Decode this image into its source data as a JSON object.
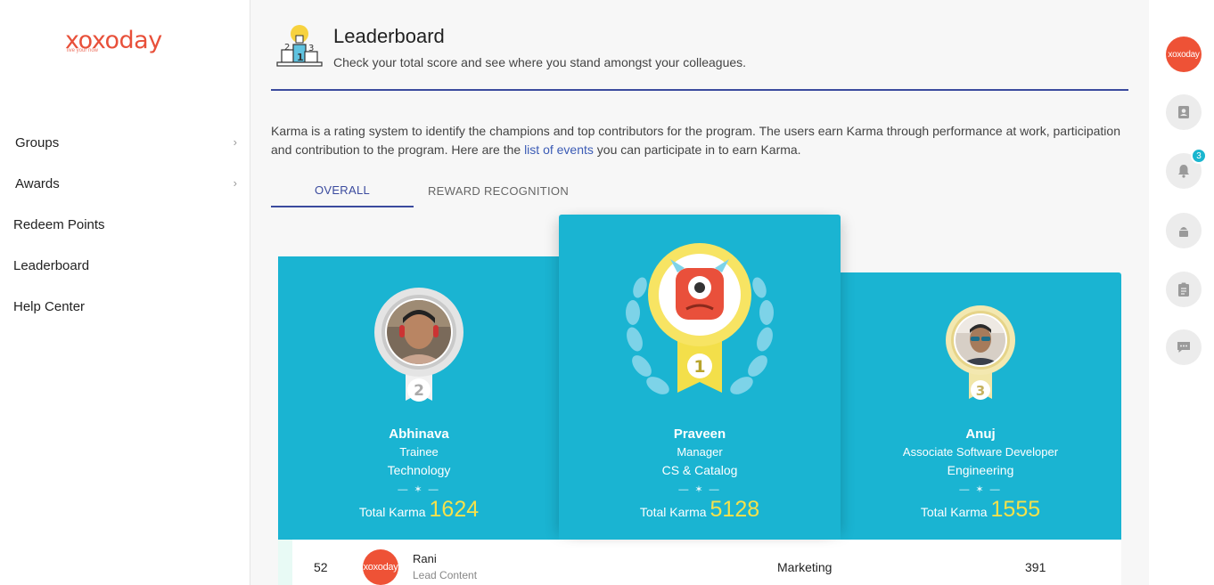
{
  "brand": {
    "logo_text": "xoxoday",
    "logo_tagline": "live your now"
  },
  "sidebar": {
    "items": [
      {
        "label": "Groups",
        "has_submenu": true
      },
      {
        "label": "Awards",
        "has_submenu": true
      },
      {
        "label": "Redeem Points",
        "has_submenu": false
      },
      {
        "label": "Leaderboard",
        "has_submenu": false
      },
      {
        "label": "Help Center",
        "has_submenu": false
      }
    ],
    "chevron": "›"
  },
  "header": {
    "title": "Leaderboard",
    "subtitle": "Check your total score and see where you stand amongst your colleagues.",
    "icon": "podium-icon",
    "icon_numbers": [
      "2",
      "1",
      "3"
    ]
  },
  "intro": {
    "text_before": "Karma is a rating system to identify the champions and top contributors for the program. The users earn Karma through performance at work, participation and contribution to the program. Here are the ",
    "link_text": "list of events",
    "text_after": " you can participate in to earn Karma."
  },
  "tabs": [
    {
      "label": "OVERALL",
      "active": true
    },
    {
      "label": "REWARD RECOGNITION",
      "active": false
    }
  ],
  "podium": {
    "separator": "— ✶ —",
    "karma_label": "Total Karma",
    "entries": [
      {
        "rank": "2",
        "name": "Abhinava",
        "role": "Trainee",
        "department": "Technology",
        "karma": "1624"
      },
      {
        "rank": "1",
        "name": "Praveen",
        "role": "Manager",
        "department": "CS & Catalog",
        "karma": "5128"
      },
      {
        "rank": "3",
        "name": "Anuj",
        "role": "Associate Software Developer",
        "department": "Engineering",
        "karma": "1555"
      }
    ]
  },
  "list": [
    {
      "rank": "52",
      "avatar_text": "xoxoday",
      "name": "Rani",
      "role": "Lead Content",
      "department": "Marketing",
      "points": "391"
    }
  ],
  "rail": {
    "avatar_text": "xoxoday",
    "notification_count": "3",
    "icons": [
      "contacts-icon",
      "bell-icon",
      "cake-icon",
      "clipboard-icon",
      "chat-icon"
    ]
  },
  "colors": {
    "brand": "#e8503a",
    "accent": "#3b4b9e",
    "podium": "#1ab4d2",
    "karma": "#f5e14a",
    "badge": "#1ab6cf"
  }
}
